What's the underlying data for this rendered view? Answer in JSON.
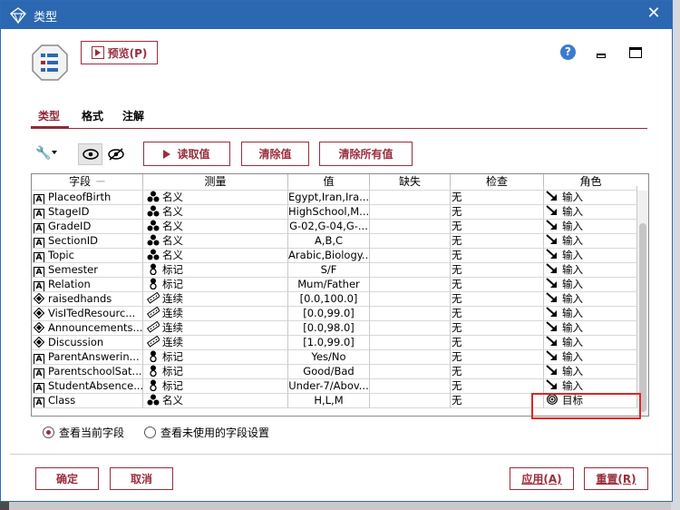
{
  "window": {
    "title": "类型",
    "close_glyph": "✕"
  },
  "toolbar": {
    "preview_label": "预览(P)",
    "help_glyph": "?"
  },
  "tabs": [
    {
      "label": "类型",
      "active": true
    },
    {
      "label": "格式",
      "active": false
    },
    {
      "label": "注解",
      "active": false
    }
  ],
  "actions": {
    "read_values": "读取值",
    "clear_values": "清除值",
    "clear_all_values": "清除所有值"
  },
  "table": {
    "columns": [
      "字段",
      "测量",
      "值",
      "缺失",
      "检查",
      "角色"
    ],
    "sort_indicator": "一",
    "partial_row": {
      "name": "PlaceofBirth",
      "measure": "名义",
      "values": "Egypt,Iran,Ira...",
      "check": "无",
      "role": "输入"
    },
    "rows": [
      {
        "name": "PlaceofBirth",
        "type_icon": "A",
        "measure": "名义",
        "measure_icon": "nominal-icon",
        "values": "Egypt,Iran,Ira...",
        "missing": "",
        "check": "无",
        "role": "输入",
        "role_icon": "input-arrow-icon"
      },
      {
        "name": "StageID",
        "type_icon": "A",
        "measure": "名义",
        "measure_icon": "nominal-icon",
        "values": "HighSchool,M...",
        "missing": "",
        "check": "无",
        "role": "输入",
        "role_icon": "input-arrow-icon"
      },
      {
        "name": "GradeID",
        "type_icon": "A",
        "measure": "名义",
        "measure_icon": "nominal-icon",
        "values": "G-02,G-04,G-...",
        "missing": "",
        "check": "无",
        "role": "输入",
        "role_icon": "input-arrow-icon"
      },
      {
        "name": "SectionID",
        "type_icon": "A",
        "measure": "名义",
        "measure_icon": "nominal-icon",
        "values": "A,B,C",
        "missing": "",
        "check": "无",
        "role": "输入",
        "role_icon": "input-arrow-icon"
      },
      {
        "name": "Topic",
        "type_icon": "A",
        "measure": "名义",
        "measure_icon": "nominal-icon",
        "values": "Arabic,Biology...",
        "missing": "",
        "check": "无",
        "role": "输入",
        "role_icon": "input-arrow-icon"
      },
      {
        "name": "Semester",
        "type_icon": "A",
        "measure": "标记",
        "measure_icon": "flag-icon",
        "values": "S/F",
        "missing": "",
        "check": "无",
        "role": "输入",
        "role_icon": "input-arrow-icon"
      },
      {
        "name": "Relation",
        "type_icon": "A",
        "measure": "标记",
        "measure_icon": "flag-icon",
        "values": "Mum/Father",
        "missing": "",
        "check": "无",
        "role": "输入",
        "role_icon": "input-arrow-icon"
      },
      {
        "name": "raisedhands",
        "type_icon": "continuous",
        "measure": "连续",
        "measure_icon": "ruler-icon",
        "values": "[0.0,100.0]",
        "missing": "",
        "check": "无",
        "role": "输入",
        "role_icon": "input-arrow-icon"
      },
      {
        "name": "VisITedResourc...",
        "type_icon": "continuous",
        "measure": "连续",
        "measure_icon": "ruler-icon",
        "values": "[0.0,99.0]",
        "missing": "",
        "check": "无",
        "role": "输入",
        "role_icon": "input-arrow-icon"
      },
      {
        "name": "Announcements...",
        "type_icon": "continuous",
        "measure": "连续",
        "measure_icon": "ruler-icon",
        "values": "[0.0,98.0]",
        "missing": "",
        "check": "无",
        "role": "输入",
        "role_icon": "input-arrow-icon"
      },
      {
        "name": "Discussion",
        "type_icon": "continuous",
        "measure": "连续",
        "measure_icon": "ruler-icon",
        "values": "[1.0,99.0]",
        "missing": "",
        "check": "无",
        "role": "输入",
        "role_icon": "input-arrow-icon"
      },
      {
        "name": "ParentAnswerin...",
        "type_icon": "A",
        "measure": "标记",
        "measure_icon": "flag-icon",
        "values": "Yes/No",
        "missing": "",
        "check": "无",
        "role": "输入",
        "role_icon": "input-arrow-icon"
      },
      {
        "name": "ParentschoolSat...",
        "type_icon": "A",
        "measure": "标记",
        "measure_icon": "flag-icon",
        "values": "Good/Bad",
        "missing": "",
        "check": "无",
        "role": "输入",
        "role_icon": "input-arrow-icon"
      },
      {
        "name": "StudentAbsence...",
        "type_icon": "A",
        "measure": "标记",
        "measure_icon": "flag-icon",
        "values": "Under-7/Abov...",
        "missing": "",
        "check": "无",
        "role": "输入",
        "role_icon": "input-arrow-icon"
      },
      {
        "name": "Class",
        "type_icon": "A",
        "measure": "名义",
        "measure_icon": "nominal-icon",
        "values": "H,L,M",
        "missing": "",
        "check": "无",
        "role": "目标",
        "role_icon": "target-icon"
      }
    ]
  },
  "view_options": {
    "current_fields": "查看当前字段",
    "unused_fields": "查看未使用的字段设置",
    "selected": "current_fields"
  },
  "buttons": {
    "ok": "确定",
    "cancel": "取消",
    "apply": "应用(A)",
    "reset": "重置(R)"
  },
  "colors": {
    "titlebar": "#2b68b1",
    "accent": "#9b2d3d",
    "highlight": "#e02424"
  }
}
